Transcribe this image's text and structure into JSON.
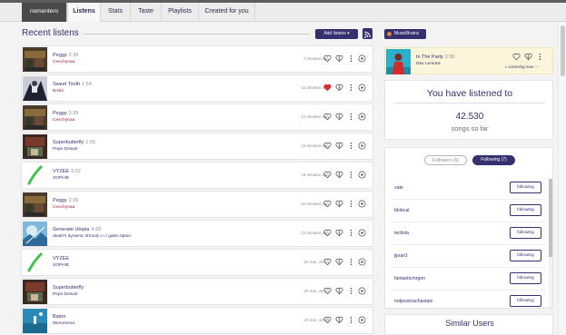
{
  "tabs": {
    "user": "nomentero",
    "listens": "Listens",
    "stats": "Stats",
    "taste": "Taste",
    "playlists": "Playlists",
    "created": "Created for you"
  },
  "main": {
    "heading": "Recent listens",
    "add_listens_label": "Add listens ▾"
  },
  "listens": [
    {
      "title": "Peggy",
      "duration": "2:39",
      "artist": "Ceechynaa",
      "time": "7 minutes ago",
      "loved": false
    },
    {
      "title": "Sweet Tooth",
      "duration": "1:54",
      "artist": "BABii",
      "time": "10 minutes ago",
      "loved": true
    },
    {
      "title": "Peggy",
      "duration": "2:39",
      "artist": "Ceechynaa",
      "time": "12 minutes ago",
      "loved": false
    },
    {
      "title": "Superbutterfly",
      "duration": "1:05",
      "artist": "Pepe Deluxé",
      "time": "15 minutes ago",
      "loved": false
    },
    {
      "title": "VYZEE",
      "duration": "3:22",
      "artist": "SOPHIE",
      "time": "16 minutes ago",
      "loved": false
    },
    {
      "title": "Peggy",
      "duration": "2:39",
      "artist": "Ceechynaa",
      "time": "20 minutes ago",
      "loved": false
    },
    {
      "title": "Generate Utopia",
      "duration": "4:29",
      "artist": "death's dynamic shroud",
      "artist_join": "and",
      "artist2": "galen tipton",
      "time": "23 minutes ago",
      "loved": false
    },
    {
      "title": "VYZEE",
      "duration": "",
      "artist": "SOPHIE",
      "time": "25 mar, 16:13",
      "loved": false
    },
    {
      "title": "Superbutterfly",
      "duration": "",
      "artist": "Pepe Deluxé",
      "time": "25 mar, 16:12",
      "loved": false
    },
    {
      "title": "Baton",
      "duration": "",
      "artist": "Menomena",
      "time": "25 mar, 16:08",
      "loved": false
    }
  ],
  "musicbrainz": {
    "label": "MusicBrainz"
  },
  "now_playing": {
    "title": "In The Party",
    "duration": "2:36",
    "artist": "Dev Lemons",
    "status": "♫ Listening now —"
  },
  "stats": {
    "heading": "You have listened to",
    "count": "42.530",
    "sub": "songs so far"
  },
  "follow": {
    "followers_label": "Followers (6)",
    "following_label": "Following (7)",
    "users": [
      "vate",
      "blobcat",
      "teclista",
      "jijean1",
      "fantasticmrgon",
      "notjessicachastain"
    ],
    "button_label": "following"
  },
  "similar": {
    "heading": "Similar Users"
  },
  "colors": {
    "accent": "#353070",
    "artist_red": "#9c2438",
    "love_red": "#d32f2f",
    "now_playing_bg": "#fdf4dc"
  }
}
